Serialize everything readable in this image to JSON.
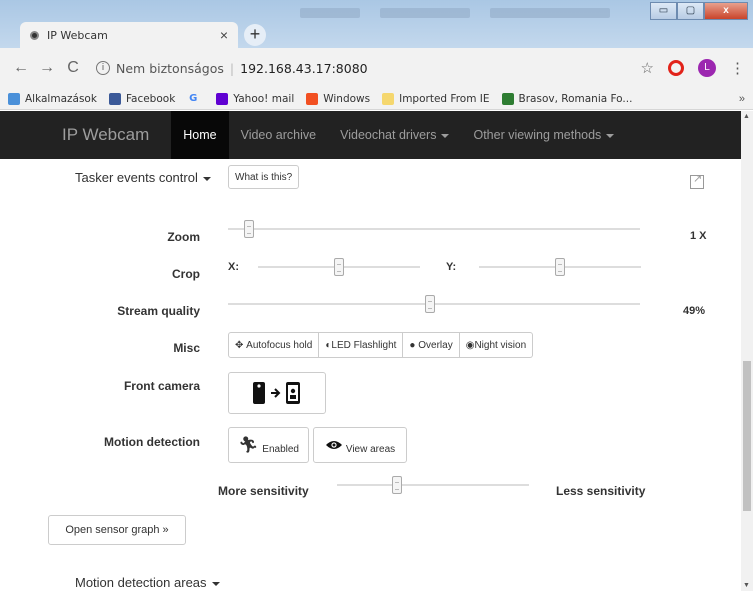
{
  "browser": {
    "tab_title": "IP Webcam",
    "tab_close": "×",
    "new_tab": "+",
    "window_buttons": {
      "minimize": "▭",
      "maximize": "▢",
      "close": "x"
    },
    "nav": {
      "back": "←",
      "forward": "→",
      "reload": "C"
    },
    "security_label": "Nem biztonságos",
    "url": "192.168.43.17:8080",
    "profile_initial": "L",
    "bookmarks": [
      {
        "label": "Alkalmazások",
        "icon_color": "#4a90d9"
      },
      {
        "label": "Facebook",
        "icon_color": "#3b5998"
      },
      {
        "label": "",
        "icon_color": "#4285f4",
        "glyph": "G"
      },
      {
        "label": "Yahoo! mail",
        "icon_color": "#6001d2"
      },
      {
        "label": "Windows",
        "icon_color": "#f25022"
      },
      {
        "label": "Imported From IE",
        "icon_color": "#f5d76e"
      },
      {
        "label": "Brasov, Romania Fo...",
        "icon_color": "#2e7d32"
      }
    ],
    "bookmarks_more": "»"
  },
  "navbar": {
    "brand": "IP Webcam",
    "items": [
      "Home",
      "Video archive",
      "Videochat drivers",
      "Other viewing methods"
    ]
  },
  "controls": {
    "tasker_label": "Tasker events control",
    "what_is_this": "What is this?",
    "zoom": {
      "label": "Zoom",
      "value": "1 X",
      "level": 0.04
    },
    "crop": {
      "label": "Crop",
      "x_label": "X:",
      "y_label": "Y:",
      "x_level": 0.5,
      "y_level": 0.5
    },
    "stream_quality": {
      "label": "Stream quality",
      "value": "49%",
      "level": 0.49
    },
    "misc": {
      "label": "Misc",
      "buttons": [
        "Autofocus hold",
        "LED Flashlight",
        "Overlay",
        "Night vision"
      ]
    },
    "front_camera": {
      "label": "Front camera"
    },
    "motion_detection": {
      "label": "Motion detection",
      "enabled_label": "Enabled",
      "view_areas_label": "View areas",
      "more_label": "More sensitivity",
      "less_label": "Less sensitivity",
      "level": 0.3
    },
    "sensor_graph_button": "Open sensor graph »",
    "motion_areas_label": "Motion detection areas"
  }
}
